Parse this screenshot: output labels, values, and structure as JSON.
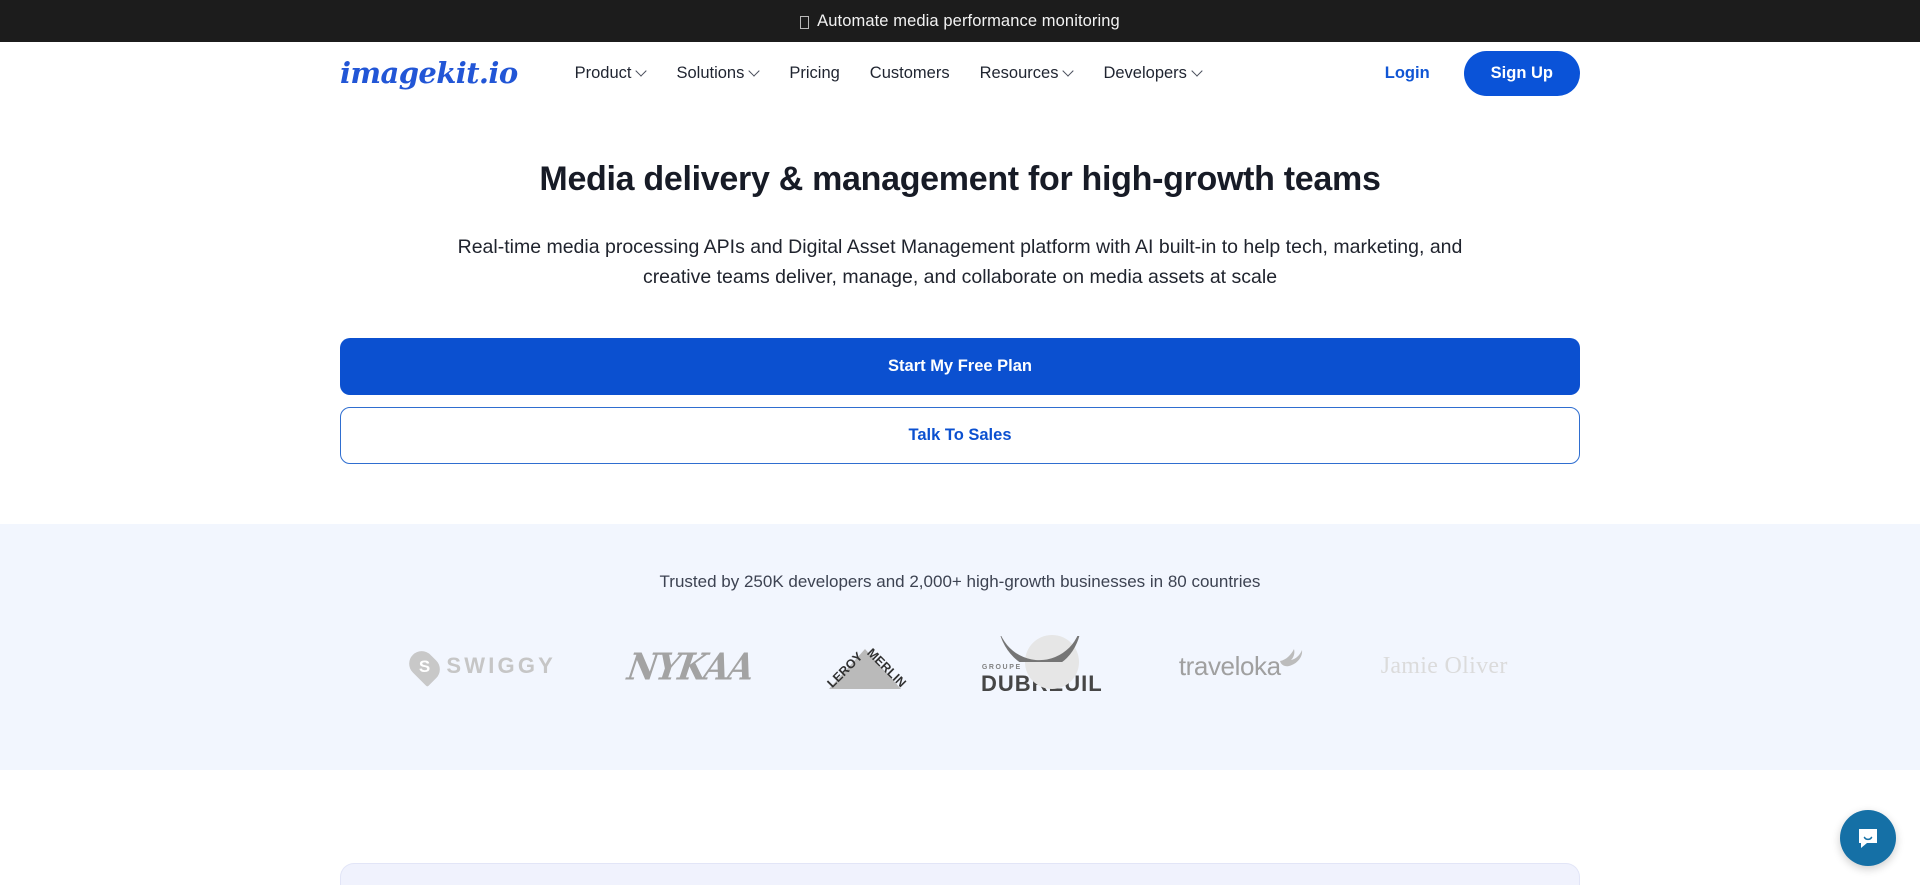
{
  "announcement": {
    "icon": "missing-glyph-icon",
    "text": "Automate media performance monitoring"
  },
  "header": {
    "logo": "imagekit.io",
    "nav": [
      {
        "label": "Product",
        "has_dropdown": true
      },
      {
        "label": "Solutions",
        "has_dropdown": true
      },
      {
        "label": "Pricing",
        "has_dropdown": false
      },
      {
        "label": "Customers",
        "has_dropdown": false
      },
      {
        "label": "Resources",
        "has_dropdown": true
      },
      {
        "label": "Developers",
        "has_dropdown": true
      }
    ],
    "login_label": "Login",
    "signup_label": "Sign Up"
  },
  "hero": {
    "title": "Media delivery & management for high-growth teams",
    "subtitle": "Real-time media processing APIs and Digital Asset Management platform with AI built-in to help tech, marketing, and creative teams deliver, manage, and collaborate on media assets at scale",
    "primary_cta": "Start My Free Plan",
    "secondary_cta": "Talk To Sales"
  },
  "trusted": {
    "text": "Trusted by 250K developers and 2,000+ high-growth businesses in 80 countries",
    "logos": [
      {
        "name": "swiggy",
        "label": "SWIGGY"
      },
      {
        "name": "nykaa",
        "label": "NYKAA"
      },
      {
        "name": "leroy-merlin",
        "label_top": "LEROY",
        "label_bottom": "MERLIN"
      },
      {
        "name": "groupe-dubreuil",
        "label_small": "GROUPE",
        "label": "DUBREUIL"
      },
      {
        "name": "traveloka",
        "label": "traveloka"
      },
      {
        "name": "jamie-oliver",
        "label": "Jamie Oliver"
      }
    ]
  },
  "chat": {
    "icon": "chat-bubble-icon"
  },
  "colors": {
    "brand_blue": "#0a53d8",
    "announce_bg": "#1c1c1c",
    "trusted_bg": "#f2f6fe",
    "chat_blue": "#1570a6"
  }
}
